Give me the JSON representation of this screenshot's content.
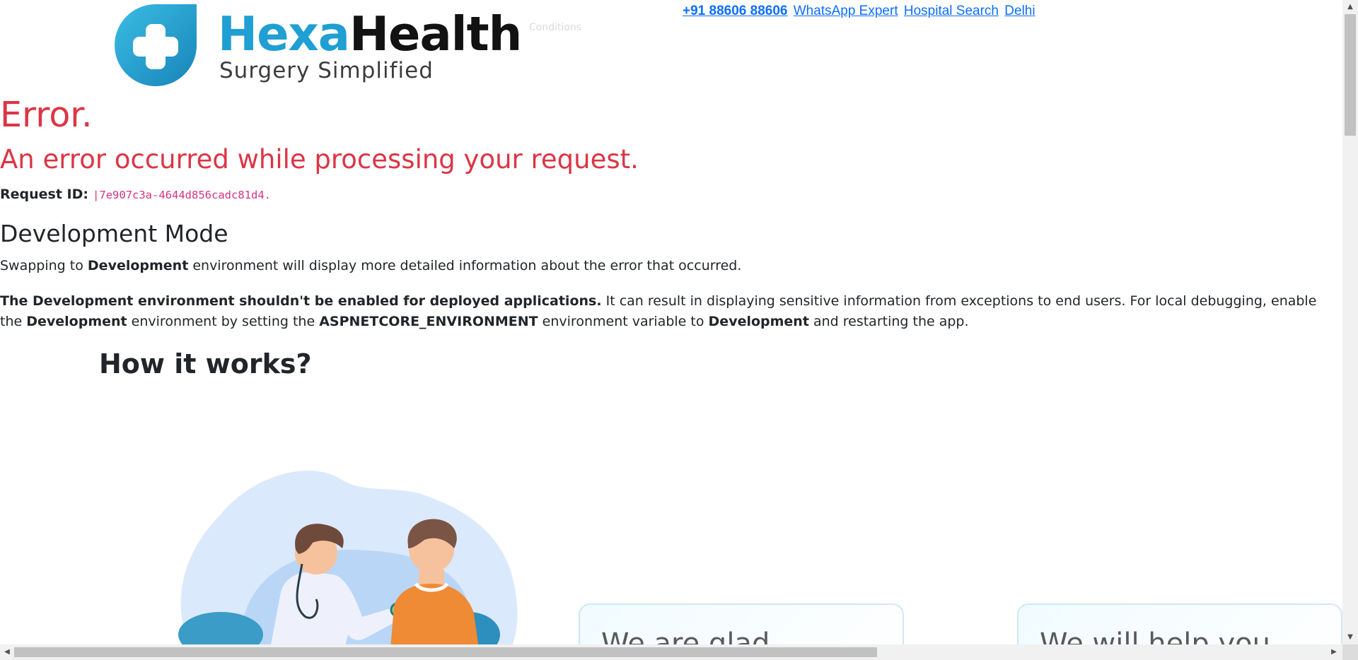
{
  "header": {
    "brand_part1": "Hexa",
    "brand_part2": "Health",
    "tagline": "Surgery Simplified",
    "overlay_text": "Conditions",
    "nav": [
      {
        "label": "+91 88606 88606"
      },
      {
        "label": "WhatsApp Expert"
      },
      {
        "label": "Hospital Search"
      },
      {
        "label": "Delhi"
      }
    ]
  },
  "error": {
    "title": "Error.",
    "subtitle": "An error occurred while processing your request.",
    "request_id_label": "Request ID:",
    "request_id_value": "|7e907c3a-4644d856cadc81d4.",
    "dev_heading": "Development Mode",
    "p1": {
      "before": "Swapping to ",
      "bold": "Development",
      "after": " environment will display more detailed information about the error that occurred."
    },
    "p2": {
      "bold1": "The Development environment shouldn't be enabled for deployed applications.",
      "text1": " It can result in displaying sensitive information from exceptions to end users. For local debugging, enable the ",
      "bold2": "Development",
      "text2": " environment by setting the ",
      "bold3": "ASPNETCORE_ENVIRONMENT",
      "text3": " environment variable to ",
      "bold4": "Development",
      "text4": " and restarting the app."
    }
  },
  "how_it_works": {
    "heading": "How it works?",
    "cards": [
      {
        "text": "We are glad"
      },
      {
        "text": "We will help you"
      }
    ]
  },
  "colors": {
    "error_red": "#dc3545",
    "link_blue": "#0d6efd",
    "brand_blue": "#1f9fd3",
    "code_pink": "#d63384"
  },
  "icons": [
    "hexahealth-logo-icon",
    "doctor-patient-illustration",
    "scroll-up-icon",
    "scroll-down-icon",
    "scroll-left-icon",
    "scroll-right-icon"
  ]
}
